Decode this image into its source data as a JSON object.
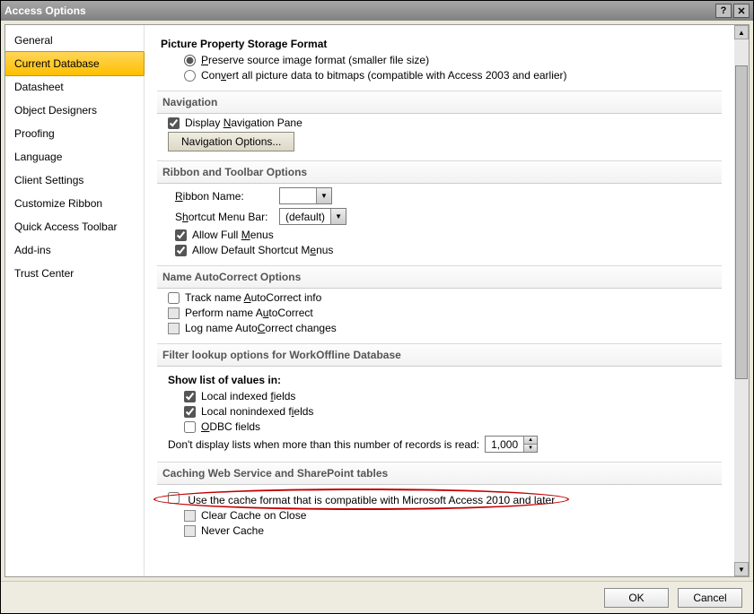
{
  "window": {
    "title": "Access Options"
  },
  "sidebar": {
    "items": [
      {
        "label": "General",
        "selected": false
      },
      {
        "label": "Current Database",
        "selected": true
      },
      {
        "label": "Datasheet",
        "selected": false
      },
      {
        "label": "Object Designers",
        "selected": false
      },
      {
        "label": "Proofing",
        "selected": false
      },
      {
        "label": "Language",
        "selected": false
      },
      {
        "label": "Client Settings",
        "selected": false
      },
      {
        "label": "Customize Ribbon",
        "selected": false
      },
      {
        "label": "Quick Access Toolbar",
        "selected": false
      },
      {
        "label": "Add-ins",
        "selected": false
      },
      {
        "label": "Trust Center",
        "selected": false
      }
    ]
  },
  "picture_section": {
    "heading": "Picture Property Storage Format",
    "option_preserve": "Preserve source image format (smaller file size)",
    "option_convert": "Convert all picture data to bitmaps (compatible with Access 2003 and earlier)"
  },
  "navigation_section": {
    "title": "Navigation",
    "display_pane": "Display Navigation Pane",
    "options_button": "Navigation Options..."
  },
  "ribbon_section": {
    "title": "Ribbon and Toolbar Options",
    "ribbon_name_label": "Ribbon Name:",
    "ribbon_name_value": "",
    "shortcut_label": "Shortcut Menu Bar:",
    "shortcut_value": "(default)",
    "allow_full_menus": "Allow Full Menus",
    "allow_default_shortcut": "Allow Default Shortcut Menus"
  },
  "autocorrect_section": {
    "title": "Name AutoCorrect Options",
    "track": "Track name AutoCorrect info",
    "perform": "Perform name AutoCorrect",
    "log": "Log name AutoCorrect changes"
  },
  "filter_section": {
    "title": "Filter lookup options for WorkOffline Database",
    "show_list": "Show list of values in:",
    "local_indexed": "Local indexed fields",
    "local_nonindexed": "Local nonindexed fields",
    "odbc": "ODBC fields",
    "dont_display_label": "Don't display lists when more than this number of records is read:",
    "dont_display_value": "1,000"
  },
  "caching_section": {
    "title": "Caching Web Service and SharePoint tables",
    "use_cache": "Use the cache format that is compatible with Microsoft Access 2010 and later",
    "clear_cache": "Clear Cache on Close",
    "never_cache": "Never Cache"
  },
  "footer": {
    "ok": "OK",
    "cancel": "Cancel"
  }
}
